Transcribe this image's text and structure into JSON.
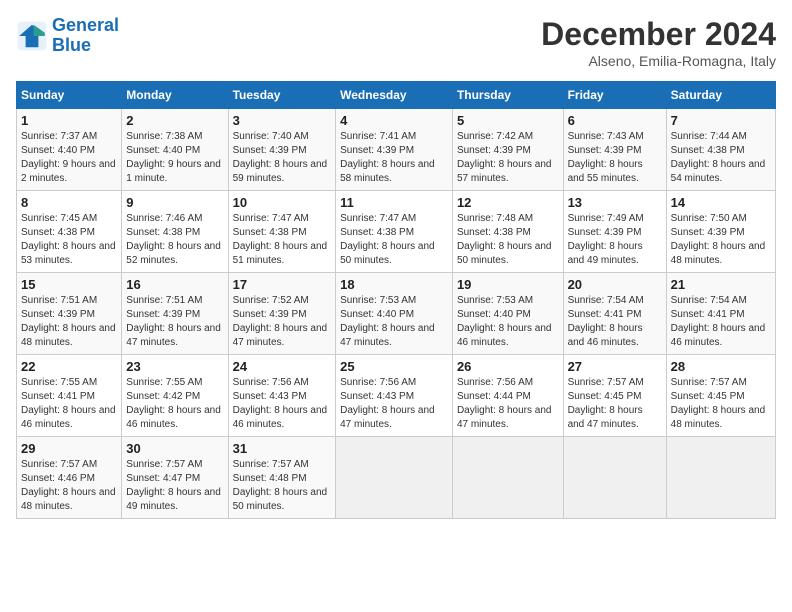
{
  "logo": {
    "line1": "General",
    "line2": "Blue"
  },
  "title": "December 2024",
  "subtitle": "Alseno, Emilia-Romagna, Italy",
  "weekdays": [
    "Sunday",
    "Monday",
    "Tuesday",
    "Wednesday",
    "Thursday",
    "Friday",
    "Saturday"
  ],
  "rows": [
    [
      {
        "day": "1",
        "sunrise": "7:37 AM",
        "sunset": "4:40 PM",
        "daylight": "9 hours and 2 minutes."
      },
      {
        "day": "2",
        "sunrise": "7:38 AM",
        "sunset": "4:40 PM",
        "daylight": "9 hours and 1 minute."
      },
      {
        "day": "3",
        "sunrise": "7:40 AM",
        "sunset": "4:39 PM",
        "daylight": "8 hours and 59 minutes."
      },
      {
        "day": "4",
        "sunrise": "7:41 AM",
        "sunset": "4:39 PM",
        "daylight": "8 hours and 58 minutes."
      },
      {
        "day": "5",
        "sunrise": "7:42 AM",
        "sunset": "4:39 PM",
        "daylight": "8 hours and 57 minutes."
      },
      {
        "day": "6",
        "sunrise": "7:43 AM",
        "sunset": "4:39 PM",
        "daylight": "8 hours and 55 minutes."
      },
      {
        "day": "7",
        "sunrise": "7:44 AM",
        "sunset": "4:38 PM",
        "daylight": "8 hours and 54 minutes."
      }
    ],
    [
      {
        "day": "8",
        "sunrise": "7:45 AM",
        "sunset": "4:38 PM",
        "daylight": "8 hours and 53 minutes."
      },
      {
        "day": "9",
        "sunrise": "7:46 AM",
        "sunset": "4:38 PM",
        "daylight": "8 hours and 52 minutes."
      },
      {
        "day": "10",
        "sunrise": "7:47 AM",
        "sunset": "4:38 PM",
        "daylight": "8 hours and 51 minutes."
      },
      {
        "day": "11",
        "sunrise": "7:47 AM",
        "sunset": "4:38 PM",
        "daylight": "8 hours and 50 minutes."
      },
      {
        "day": "12",
        "sunrise": "7:48 AM",
        "sunset": "4:38 PM",
        "daylight": "8 hours and 50 minutes."
      },
      {
        "day": "13",
        "sunrise": "7:49 AM",
        "sunset": "4:39 PM",
        "daylight": "8 hours and 49 minutes."
      },
      {
        "day": "14",
        "sunrise": "7:50 AM",
        "sunset": "4:39 PM",
        "daylight": "8 hours and 48 minutes."
      }
    ],
    [
      {
        "day": "15",
        "sunrise": "7:51 AM",
        "sunset": "4:39 PM",
        "daylight": "8 hours and 48 minutes."
      },
      {
        "day": "16",
        "sunrise": "7:51 AM",
        "sunset": "4:39 PM",
        "daylight": "8 hours and 47 minutes."
      },
      {
        "day": "17",
        "sunrise": "7:52 AM",
        "sunset": "4:39 PM",
        "daylight": "8 hours and 47 minutes."
      },
      {
        "day": "18",
        "sunrise": "7:53 AM",
        "sunset": "4:40 PM",
        "daylight": "8 hours and 47 minutes."
      },
      {
        "day": "19",
        "sunrise": "7:53 AM",
        "sunset": "4:40 PM",
        "daylight": "8 hours and 46 minutes."
      },
      {
        "day": "20",
        "sunrise": "7:54 AM",
        "sunset": "4:41 PM",
        "daylight": "8 hours and 46 minutes."
      },
      {
        "day": "21",
        "sunrise": "7:54 AM",
        "sunset": "4:41 PM",
        "daylight": "8 hours and 46 minutes."
      }
    ],
    [
      {
        "day": "22",
        "sunrise": "7:55 AM",
        "sunset": "4:41 PM",
        "daylight": "8 hours and 46 minutes."
      },
      {
        "day": "23",
        "sunrise": "7:55 AM",
        "sunset": "4:42 PM",
        "daylight": "8 hours and 46 minutes."
      },
      {
        "day": "24",
        "sunrise": "7:56 AM",
        "sunset": "4:43 PM",
        "daylight": "8 hours and 46 minutes."
      },
      {
        "day": "25",
        "sunrise": "7:56 AM",
        "sunset": "4:43 PM",
        "daylight": "8 hours and 47 minutes."
      },
      {
        "day": "26",
        "sunrise": "7:56 AM",
        "sunset": "4:44 PM",
        "daylight": "8 hours and 47 minutes."
      },
      {
        "day": "27",
        "sunrise": "7:57 AM",
        "sunset": "4:45 PM",
        "daylight": "8 hours and 47 minutes."
      },
      {
        "day": "28",
        "sunrise": "7:57 AM",
        "sunset": "4:45 PM",
        "daylight": "8 hours and 48 minutes."
      }
    ],
    [
      {
        "day": "29",
        "sunrise": "7:57 AM",
        "sunset": "4:46 PM",
        "daylight": "8 hours and 48 minutes."
      },
      {
        "day": "30",
        "sunrise": "7:57 AM",
        "sunset": "4:47 PM",
        "daylight": "8 hours and 49 minutes."
      },
      {
        "day": "31",
        "sunrise": "7:57 AM",
        "sunset": "4:48 PM",
        "daylight": "8 hours and 50 minutes."
      },
      null,
      null,
      null,
      null
    ]
  ]
}
